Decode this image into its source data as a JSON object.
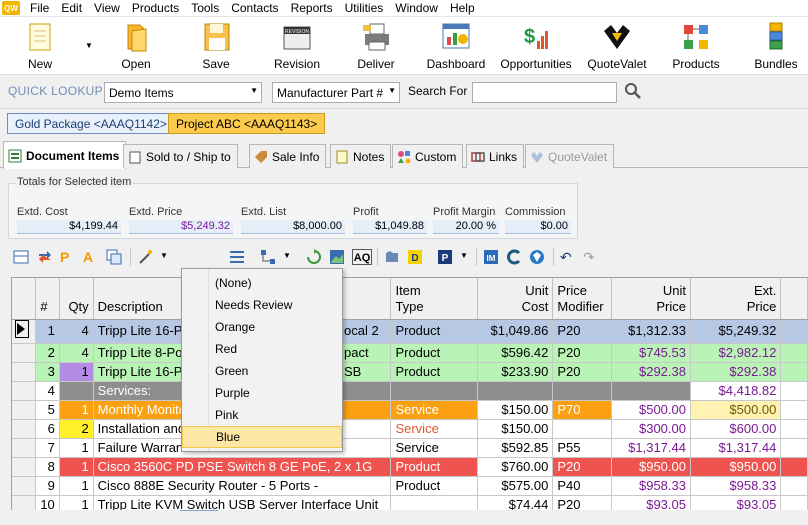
{
  "menu": [
    "File",
    "Edit",
    "View",
    "Products",
    "Tools",
    "Contacts",
    "Reports",
    "Utilities",
    "Window",
    "Help"
  ],
  "app_logo": "QW",
  "toolbar": {
    "new": "New",
    "open": "Open",
    "save": "Save",
    "revision": "Revision",
    "revision_icon_text": "REVISION",
    "deliver": "Deliver",
    "dashboard": "Dashboard",
    "opportunities": "Opportunities",
    "quotevalet": "QuoteValet",
    "products": "Products",
    "bundles": "Bundles"
  },
  "lookup": {
    "label": "QUICK LOOKUP",
    "source": "Demo Items",
    "field": "Manufacturer Part #",
    "search_label": "Search For",
    "search_value": ""
  },
  "documents": [
    "Gold Package <AAAQ1142>",
    "Project ABC <AAAQ1143>"
  ],
  "tabs": {
    "document_items": "Document Items",
    "sold_to": "Sold to / Ship to",
    "sale_info": "Sale Info",
    "notes": "Notes",
    "custom": "Custom",
    "links": "Links",
    "quotevalet": "QuoteValet"
  },
  "totals": {
    "title": "Totals for Selected item",
    "extd_cost": {
      "label": "Extd. Cost",
      "value": "$4,199.44"
    },
    "extd_price": {
      "label": "Extd. Price",
      "value": "$5,249.32"
    },
    "extd_list": {
      "label": "Extd. List",
      "value": "$8,000.00"
    },
    "profit": {
      "label": "Profit",
      "value": "$1,049.88"
    },
    "profit_margin": {
      "label": "Profit Margin",
      "value": "20.00 %"
    },
    "commission": {
      "label": "Commission",
      "value": "$0.00"
    }
  },
  "grid": {
    "headers": {
      "num": "#",
      "qty": "Qty",
      "desc": "Description",
      "item_type_1": "Item",
      "item_type_2": "Type",
      "unit_cost_1": "Unit",
      "unit_cost_2": "Cost",
      "price_mod_1": "Price",
      "price_mod_2": "Modifier",
      "unit_price_1": "Unit",
      "unit_price_2": "Price",
      "ext_price_1": "Ext.",
      "ext_price_2": "Price"
    },
    "rows": [
      {
        "n": "1",
        "qty": "4",
        "desc": "Tripp Lite 16-P",
        "desc2": "ocal 2",
        "type": "Product",
        "cost": "$1,049.86",
        "mod": "P20",
        "uprice": "$1,312.33",
        "eprice": "$5,249.32"
      },
      {
        "n": "2",
        "qty": "4",
        "desc": "Tripp Lite 8-Po",
        "desc2": "pact",
        "type": "Product",
        "cost": "$596.42",
        "mod": "P20",
        "uprice": "$745.53",
        "eprice": "$2,982.12"
      },
      {
        "n": "3",
        "qty": "1",
        "desc": "Tripp Lite 16-P",
        "desc2": "SB",
        "type": "Product",
        "cost": "$233.90",
        "mod": "P20",
        "uprice": "$292.38",
        "eprice": "$292.38"
      },
      {
        "n": "4",
        "qty": "",
        "desc": "Services:",
        "desc2": "",
        "type": "",
        "cost": "",
        "mod": "",
        "uprice": "",
        "eprice": "$4,418.82"
      },
      {
        "n": "5",
        "qty": "1",
        "desc": "Monthly Monito",
        "desc2": "",
        "type": "Service",
        "cost": "$150.00",
        "mod": "P70",
        "uprice": "$500.00",
        "eprice": "$500.00"
      },
      {
        "n": "6",
        "qty": "2",
        "desc": "Installation and",
        "desc2": "",
        "type": "Service",
        "cost": "$150.00",
        "mod": "",
        "uprice": "$300.00",
        "eprice": "$600.00"
      },
      {
        "n": "7",
        "qty": "1",
        "desc": "Failure Warran",
        "desc2": "",
        "type": "Service",
        "cost": "$592.85",
        "mod": "P55",
        "uprice": "$1,317.44",
        "eprice": "$1,317.44"
      },
      {
        "n": "8",
        "qty": "1",
        "desc": "Cisco 3560C PD PSE Switch 8 GE PoE, 2 x 1G",
        "desc2": "",
        "type": "Product",
        "cost": "$760.00",
        "mod": "P20",
        "uprice": "$950.00",
        "eprice": "$950.00"
      },
      {
        "n": "9",
        "qty": "1",
        "desc": "Cisco 888E Security Router - 5 Ports -",
        "desc2": "",
        "type": "Product",
        "cost": "$575.00",
        "mod": "P40",
        "uprice": "$958.33",
        "eprice": "$958.33"
      },
      {
        "n": "10",
        "qty": "1",
        "desc": "Tripp Lite KVM Switch USB Server Interface Unit",
        "desc2": "",
        "type": "",
        "cost": "$74.44",
        "mod": "P20",
        "uprice": "$93.05",
        "eprice": "$93.05"
      }
    ]
  },
  "color_menu": [
    "(None)",
    "Needs Review",
    "Orange",
    "Red",
    "Green",
    "Purple",
    "Pink",
    "Blue"
  ],
  "colors": {
    "blue_row": "#b6c8e4",
    "green_row": "#b9f3b5",
    "orange_row": "#fba010",
    "red_row": "#ef5350",
    "gray_row": "#8e8e8e",
    "purple_qty": "#b48ce6",
    "yellow_qty": "#fff02a",
    "price_purple": "#7a1a94"
  }
}
